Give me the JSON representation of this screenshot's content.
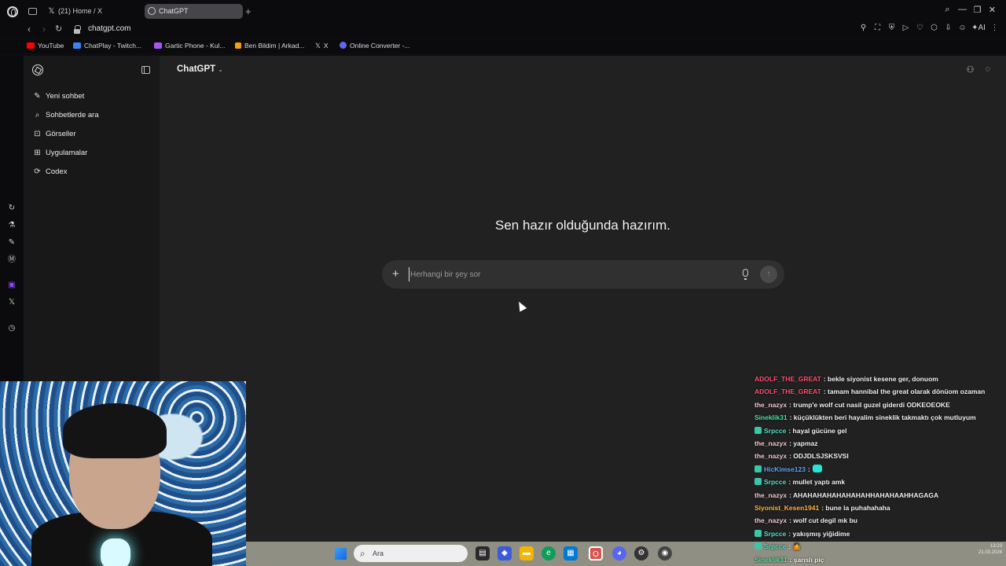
{
  "browser": {
    "tabs": [
      {
        "label": "(21) Home / X",
        "icon": "x-icon"
      },
      {
        "label": "ChatGPT",
        "icon": "chatgpt-icon",
        "active": true
      }
    ],
    "address": "chatgpt.com",
    "bookmarks": [
      {
        "label": "YouTube",
        "color": "#ff0000"
      },
      {
        "label": "ChatPlay - Twitch...",
        "color": "#3b82f6"
      },
      {
        "label": "Gartic Phone - Kul...",
        "color": "#a855f7"
      },
      {
        "label": "Ben Bildim | Arkad...",
        "color": "#f59e0b"
      },
      {
        "label": "X",
        "color": "#e5e5e5"
      },
      {
        "label": "Online Converter -...",
        "color": "#6366f1"
      }
    ]
  },
  "sidebar": {
    "items": [
      {
        "label": "Yeni sohbet",
        "icon": "pencil-square-icon"
      },
      {
        "label": "Sohbetlerde ara",
        "icon": "search-icon"
      },
      {
        "label": "Görseller",
        "icon": "image-icon"
      },
      {
        "label": "Uygulamalar",
        "icon": "grid-icon"
      },
      {
        "label": "Codex",
        "icon": "codex-icon"
      }
    ]
  },
  "main": {
    "model": "ChatGPT",
    "headline": "Sen hazır olduğunda hazırım.",
    "composer": {
      "placeholder": "Herhangi bir şey sor"
    }
  },
  "taskbar": {
    "search_label": "Ara",
    "clock_time": "13:23",
    "clock_date": "21.03.2026"
  },
  "chat": [
    {
      "user": "ADOLF_THE_GREAT",
      "color": "#ff4f6d",
      "text": ": bekle siyonist kesene ger, donuom"
    },
    {
      "user": "ADOLF_THE_GREAT",
      "color": "#ff4f6d",
      "text": ": tamam hannibal the great olarak dönüom ozaman"
    },
    {
      "user": "the_nazyx",
      "color": "#f5c6d6",
      "text": ": trump'e wolf cut nasil guzel giderdi ODKEOEOKE"
    },
    {
      "user": "Sineklik31",
      "color": "#4ee3a0",
      "text": ": küçüklükten beri hayalim sineklik takmaktı çok mutluyum"
    },
    {
      "user": "Srpcce",
      "color": "#4ee3c6",
      "text": ": hayal gücüne gel",
      "badge": true
    },
    {
      "user": "the_nazyx",
      "color": "#f5c6d6",
      "text": ": yapmaz"
    },
    {
      "user": "the_nazyx",
      "color": "#f5c6d6",
      "text": ": ODJDLSJSKSVSI"
    },
    {
      "user": "HicKimse123",
      "color": "#5aa7ff",
      "text": ":",
      "badge": true,
      "emote": true
    },
    {
      "user": "Srpcce",
      "color": "#4ee3c6",
      "text": ": mullet yaptı amk",
      "badge": true
    },
    {
      "user": "the_nazyx",
      "color": "#f5c6d6",
      "text": ": AHAHAHAHAHAHAHAHHAHAHAAHHAGAGA"
    },
    {
      "user": "Siyonist_Kesen1941",
      "color": "#ffb347",
      "text": ": bune la puhahahaha"
    },
    {
      "user": "the_nazyx",
      "color": "#f5c6d6",
      "text": ": wolf cut degil mk bu"
    },
    {
      "user": "Srpcce",
      "color": "#4ee3c6",
      "text": ": yakışmış yiğidime",
      "badge": true
    },
    {
      "user": "Srpcce",
      "color": "#4ee3c6",
      "text": ": 🤷",
      "badge": true
    },
    {
      "user": "Sineklik31",
      "color": "#4ee3a0",
      "text": ": şanslı piç"
    }
  ]
}
